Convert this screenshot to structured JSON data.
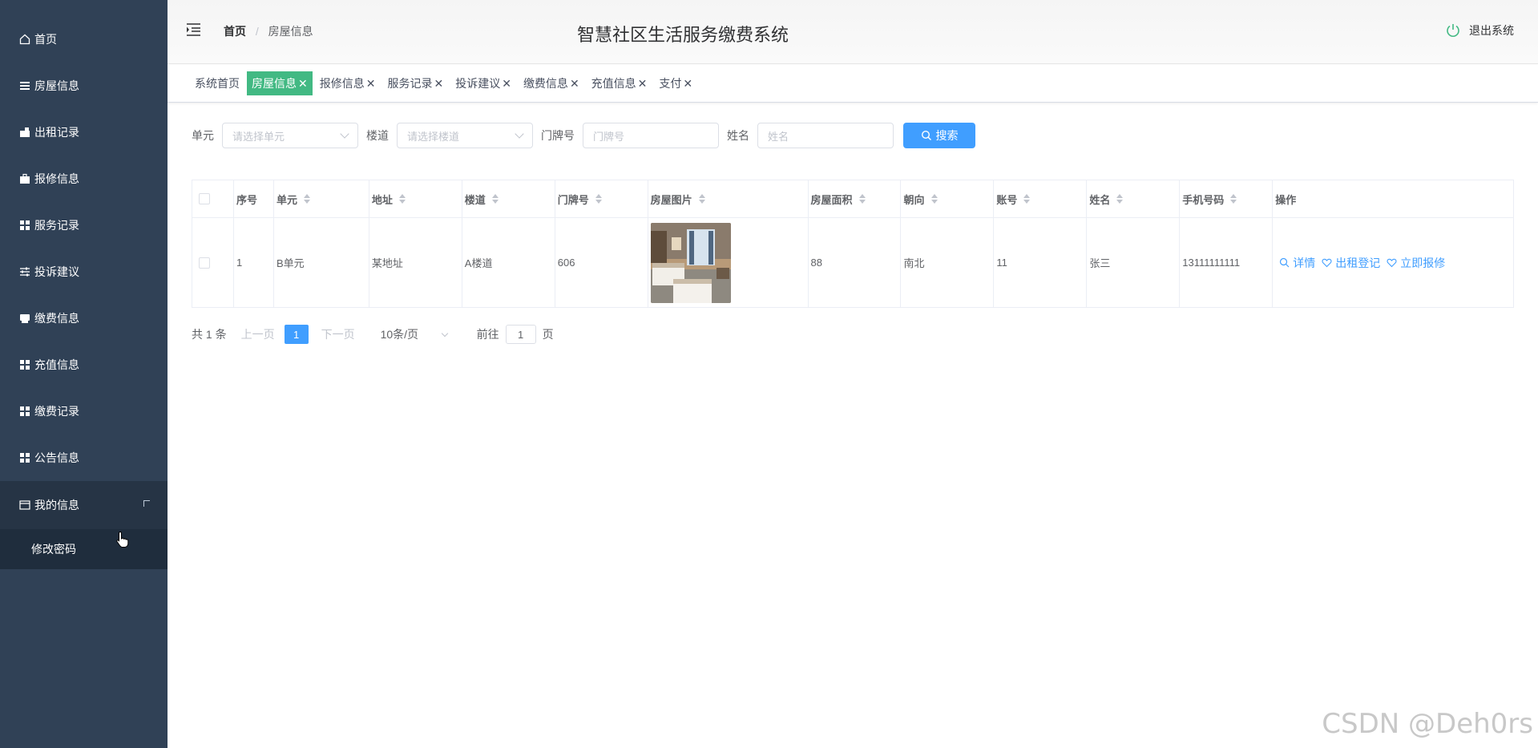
{
  "sidebar": {
    "items": [
      {
        "label": "首页",
        "icon": "home-icon"
      },
      {
        "label": "房屋信息",
        "icon": "list-icon"
      },
      {
        "label": "出租记录",
        "icon": "rent-icon"
      },
      {
        "label": "报修信息",
        "icon": "briefcase-icon"
      },
      {
        "label": "服务记录",
        "icon": "grid-icon"
      },
      {
        "label": "投诉建议",
        "icon": "sliders-icon"
      },
      {
        "label": "缴费信息",
        "icon": "printer-icon"
      },
      {
        "label": "充值信息",
        "icon": "grid-icon"
      },
      {
        "label": "缴费记录",
        "icon": "grid-icon"
      },
      {
        "label": "公告信息",
        "icon": "grid-icon"
      }
    ],
    "open_menu": {
      "label": "我的信息",
      "icon": "card-icon",
      "submenu": [
        "修改密码"
      ]
    },
    "bg_color": "#304156"
  },
  "header": {
    "breadcrumb_home": "首页",
    "breadcrumb_sep": "/",
    "breadcrumb_current": "房屋信息",
    "title": "智慧社区生活服务缴费系统",
    "logout_label": "退出系统"
  },
  "tags": [
    {
      "label": "系统首页",
      "closable": false,
      "active": false
    },
    {
      "label": "房屋信息",
      "closable": true,
      "active": true
    },
    {
      "label": "报修信息",
      "closable": true,
      "active": false
    },
    {
      "label": "服务记录",
      "closable": true,
      "active": false
    },
    {
      "label": "投诉建议",
      "closable": true,
      "active": false
    },
    {
      "label": "缴费信息",
      "closable": true,
      "active": false
    },
    {
      "label": "充值信息",
      "closable": true,
      "active": false
    },
    {
      "label": "支付",
      "closable": true,
      "active": false
    }
  ],
  "search": {
    "unit_label": "单元",
    "unit_placeholder": "请选择单元",
    "building_label": "楼道",
    "building_placeholder": "请选择楼道",
    "door_label": "门牌号",
    "door_placeholder": "门牌号",
    "name_label": "姓名",
    "name_placeholder": "姓名",
    "search_button": "搜索"
  },
  "table": {
    "columns": [
      "序号",
      "单元",
      "地址",
      "楼道",
      "门牌号",
      "房屋图片",
      "房屋面积",
      "朝向",
      "账号",
      "姓名",
      "手机号码",
      "操作"
    ],
    "rows": [
      {
        "index": "1",
        "unit": "B单元",
        "address": "某地址",
        "building": "A楼道",
        "door": "606",
        "area": "88",
        "orientation": "南北",
        "account": "11",
        "name": "张三",
        "phone": "13111111111"
      }
    ],
    "actions": [
      "详情",
      "出租登记",
      "立即报修"
    ]
  },
  "pagination": {
    "total": "共 1 条",
    "prev": "上一页",
    "current_page": "1",
    "next": "下一页",
    "page_size": "10条/页",
    "goto_label": "前往",
    "goto_value": "1",
    "page_unit": "页"
  },
  "watermark": "CSDN @Deh0rs",
  "colors": {
    "primary": "#409eff",
    "active_tag": "#42b983"
  }
}
